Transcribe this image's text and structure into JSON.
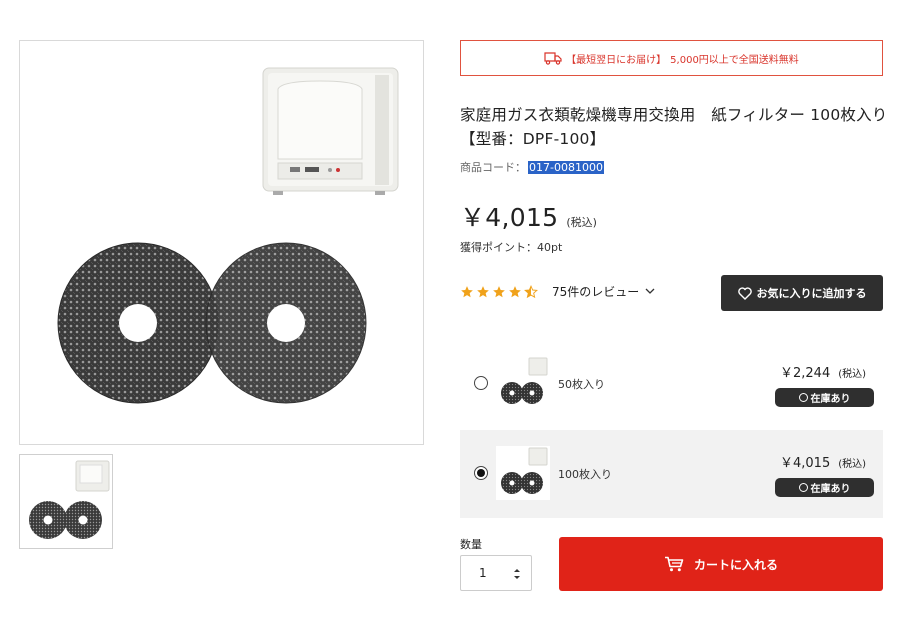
{
  "shipping_banner": {
    "highlight": "【最短翌日にお届け】",
    "text": "5,000円以上で全国送料無料",
    "icon": "truck-icon"
  },
  "product": {
    "title": "家庭用ガス衣類乾燥機専用交換用　紙フィルター 100枚入り【型番：DPF-100】",
    "code_label": "商品コード：",
    "code_value": "017-0081000",
    "price": "￥4,015",
    "tax_label": "(税込)",
    "points": "獲得ポイント：40pt"
  },
  "rating": {
    "value": 4.5,
    "max": 5,
    "reviews_label": "75件のレビュー",
    "color": "#f0a21b"
  },
  "favorite_button": {
    "label": "お気に入りに追加する",
    "icon": "heart-icon"
  },
  "variants": [
    {
      "label": "50枚入り",
      "price": "￥2,244",
      "tax": "(税込)",
      "stock": "在庫あり",
      "selected": false
    },
    {
      "label": "100枚入り",
      "price": "￥4,015",
      "tax": "(税込)",
      "stock": "在庫あり",
      "selected": true
    }
  ],
  "quantity": {
    "label": "数量",
    "value": "1"
  },
  "cart_button": {
    "label": "カートに入れる",
    "icon": "cart-icon"
  },
  "colors": {
    "accent_red": "#e02318",
    "dark_button": "#2f2f2f",
    "highlight_blue": "#2a63c7"
  }
}
